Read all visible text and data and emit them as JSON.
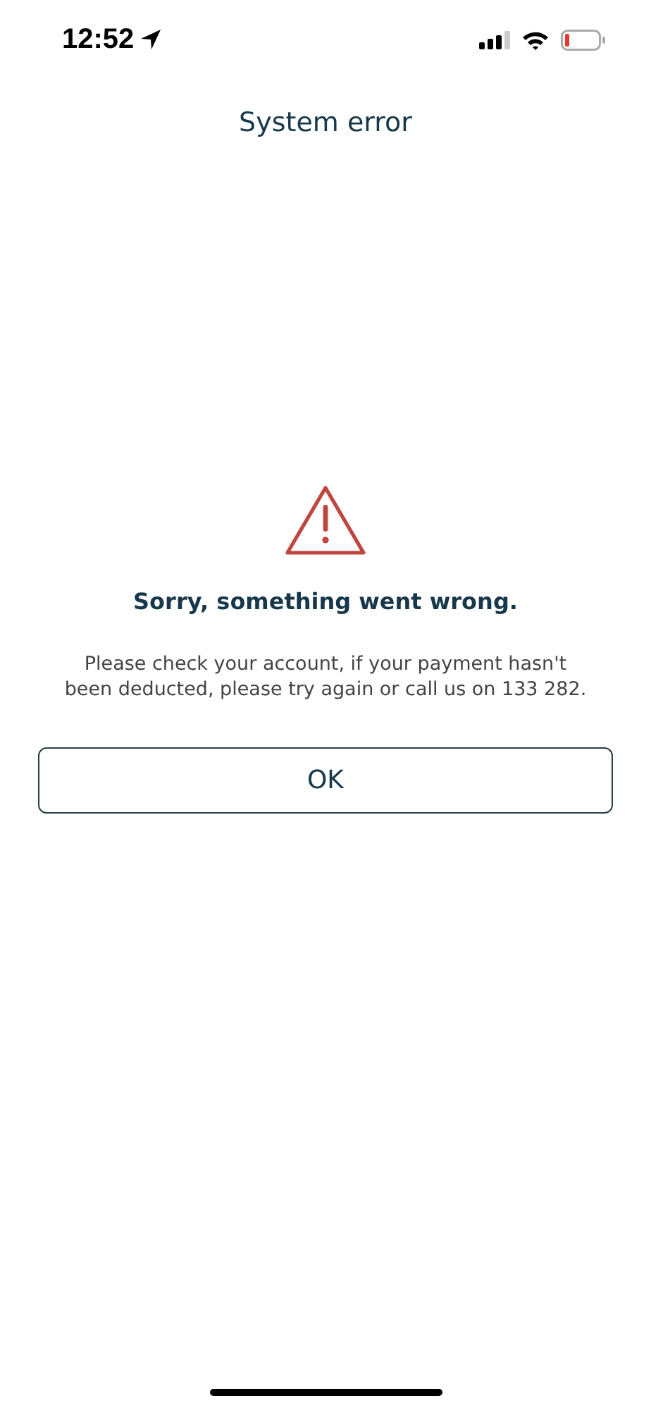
{
  "status_bar": {
    "time": "12:52"
  },
  "header": {
    "title": "System error"
  },
  "error": {
    "heading": "Sorry, something went wrong.",
    "message": "Please check your account, if your payment hasn't been deducted, please try again or call us on 133 282."
  },
  "buttons": [
    "OK"
  ]
}
